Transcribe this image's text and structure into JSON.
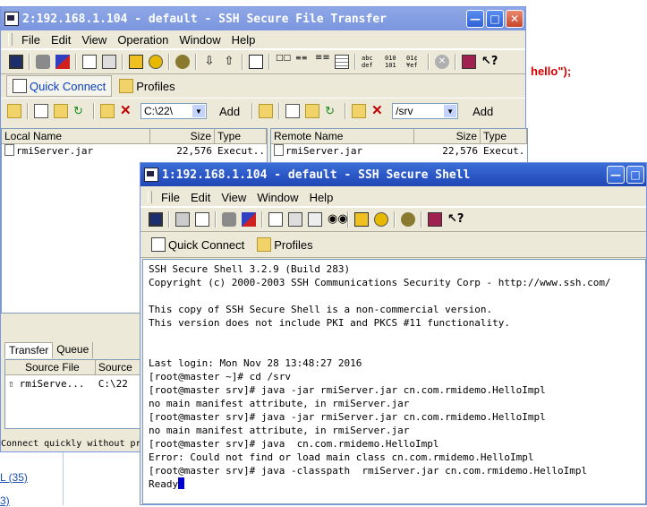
{
  "background": {
    "code_fragment": "hello\");",
    "links": [
      "L (35)",
      "3)"
    ]
  },
  "sftp_window": {
    "title": "2:192.168.1.104 - default - SSH Secure File Transfer",
    "menu": [
      "File",
      "Edit",
      "View",
      "Operation",
      "Window",
      "Help"
    ],
    "toolbar_text": {
      "abc": "abc\ndef",
      "bin": "010\n101",
      "mixed": "01¢\n¥ef"
    },
    "quick_connect": "Quick Connect",
    "profiles": "Profiles",
    "local_path": "C:\\22\\",
    "remote_path": "/srv",
    "add_label": "Add",
    "local_headers": {
      "name": "Local Name",
      "size": "Size",
      "type": "Type"
    },
    "remote_headers": {
      "name": "Remote Name",
      "size": "Size",
      "type": "Type"
    },
    "local_files": [
      {
        "name": "rmiServer.jar",
        "size": "22,576",
        "type": "Execut..."
      }
    ],
    "remote_files": [
      {
        "name": "rmiServer.jar",
        "size": "22,576",
        "type": "Execut."
      }
    ],
    "transfer_tabs": [
      "Transfer",
      "Queue"
    ],
    "transfer_headers": {
      "source_file": "Source File",
      "source": "Source"
    },
    "transfer_row": {
      "file": "rmiServe...",
      "source": "C:\\22"
    },
    "status_text": "Connect quickly without pr"
  },
  "ssh_window": {
    "title": "1:192.168.1.104 - default - SSH Secure Shell",
    "menu": [
      "File",
      "Edit",
      "View",
      "Window",
      "Help"
    ],
    "quick_connect": "Quick Connect",
    "profiles": "Profiles",
    "terminal_lines": [
      "SSH Secure Shell 3.2.9 (Build 283)",
      "Copyright (c) 2000-2003 SSH Communications Security Corp - http://www.ssh.com/",
      "",
      "This copy of SSH Secure Shell is a non-commercial version.",
      "This version does not include PKI and PKCS #11 functionality.",
      "",
      "",
      "Last login: Mon Nov 28 13:48:27 2016",
      "[root@master ~]# cd /srv",
      "[root@master srv]# java -jar rmiServer.jar cn.com.rmidemo.HelloImpl",
      "no main manifest attribute, in rmiServer.jar",
      "[root@master srv]# java -jar rmiServer.jar cn.com.rmidemo.HelloImpl",
      "no main manifest attribute, in rmiServer.jar",
      "[root@master srv]# java  cn.com.rmidemo.HelloImpl",
      "Error: Could not find or load main class cn.com.rmidemo.HelloImpl",
      "[root@master srv]# java -classpath  rmiServer.jar cn.com.rmidemo.HelloImpl"
    ],
    "terminal_last": "Ready"
  }
}
